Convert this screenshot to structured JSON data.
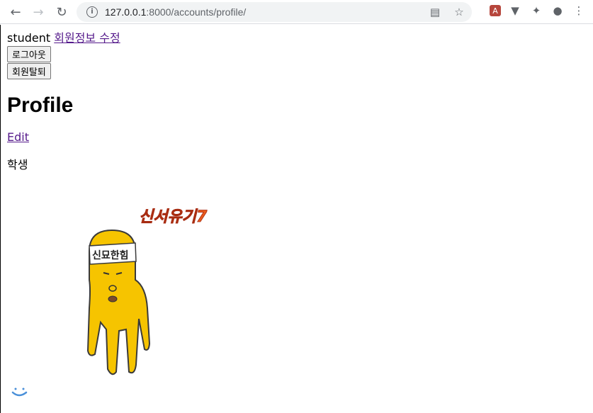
{
  "browser": {
    "url_host": "127.0.0.1",
    "url_path": ":8000/accounts/profile/"
  },
  "nav": {
    "username": "student",
    "edit_profile_link": "회원정보 수정",
    "logout_button": "로그아웃",
    "delete_account_button": "회원탈퇴"
  },
  "main": {
    "title": "Profile",
    "edit_link": "Edit",
    "role": "학생"
  },
  "image": {
    "logo_text": "신서유기7",
    "headband_text": "신묘한힘"
  }
}
